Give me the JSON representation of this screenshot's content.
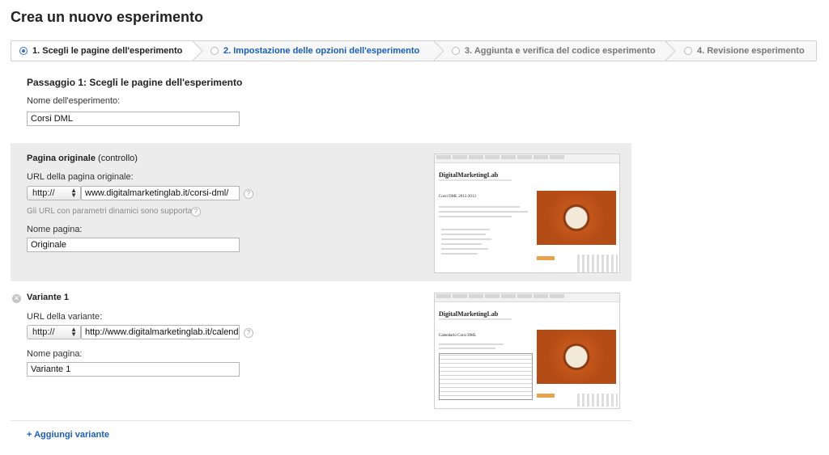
{
  "page_title": "Crea un nuovo esperimento",
  "steps": [
    {
      "label": "1. Scegli le pagine dell'esperimento"
    },
    {
      "label": "2. Impostazione delle opzioni dell'esperimento"
    },
    {
      "label": "3. Aggiunta e verifica del codice esperimento"
    },
    {
      "label": "4. Revisione esperimento"
    }
  ],
  "section_title": "Passaggio 1: Scegli le pagine dell'esperimento",
  "experiment": {
    "name_label": "Nome dell'esperimento:",
    "name_value": "Corsi DML"
  },
  "original": {
    "heading_bold": "Pagina originale",
    "heading_rest": " (controllo)",
    "url_label": "URL della pagina originale:",
    "protocol": "http://",
    "url_value": "www.digitalmarketinglab.it/corsi-dml/",
    "note": "Gli URL con parametri dinamici sono supportati.",
    "page_name_label": "Nome pagina:",
    "page_name_value": "Originale"
  },
  "variant": {
    "heading": "Variante 1",
    "url_label": "URL della variante:",
    "protocol": "http://",
    "url_value": "http://www.digitalmarketinglab.it/calendario",
    "page_name_label": "Nome pagina:",
    "page_name_value": "Variante 1"
  },
  "thumbnails": {
    "brand": "DigitalMarketingLab",
    "original_heading": "Corsi DML 2012-2013",
    "variant_heading": "Calendario Corsi DML"
  },
  "add_variant_label": "+ Aggiungi variante",
  "colors": {
    "accent": "#1a5fb4",
    "panel": "#ececec"
  }
}
